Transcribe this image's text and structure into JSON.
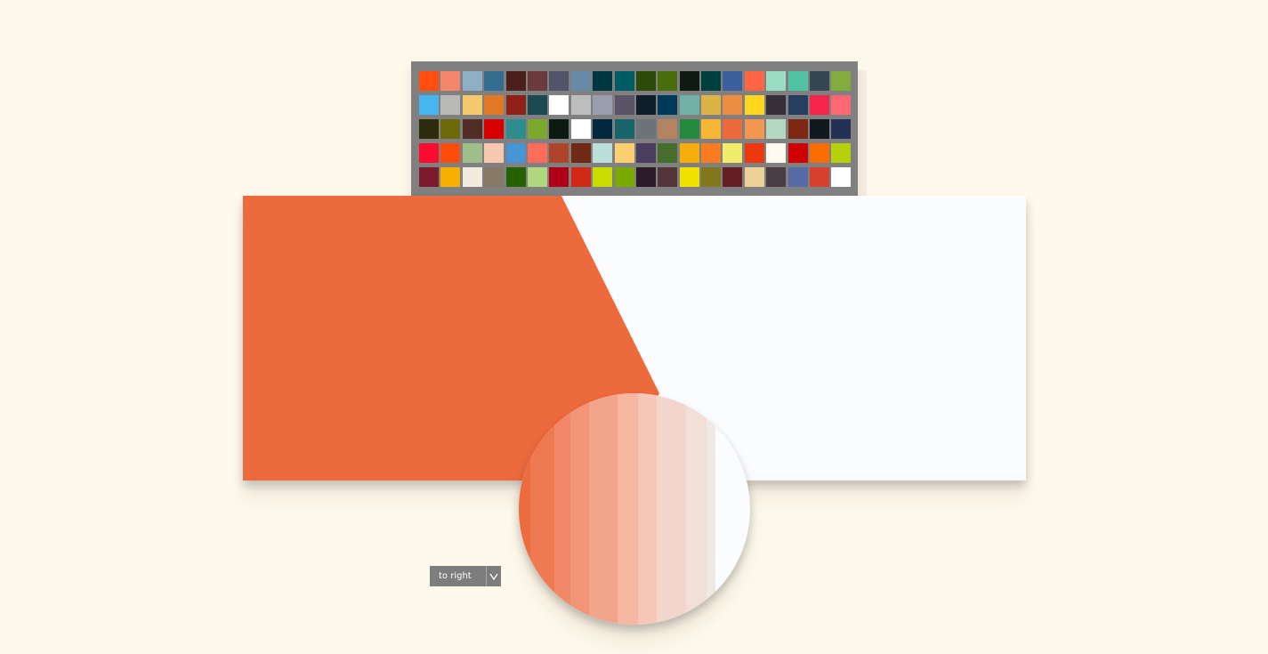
{
  "palette": {
    "swatches": [
      "#ff4e0f",
      "#f4876a",
      "#8fafc4",
      "#336e90",
      "#4a1e1a",
      "#6a3a3c",
      "#51546a",
      "#698aa6",
      "#003640",
      "#005c64",
      "#2e4a08",
      "#486e0c",
      "#0e1a12",
      "#00403c",
      "#3d5e9c",
      "#ff6543",
      "#9bdcc4",
      "#52c2a4",
      "#344752",
      "#82ac3e",
      "#46b6f0",
      "#b9b9b7",
      "#f4c86c",
      "#e07824",
      "#8e2016",
      "#1c4a52",
      "#ffffff",
      "#bdbdbd",
      "#999fad",
      "#5c5366",
      "#101e2a",
      "#00395a",
      "#70b2a6",
      "#dcb446",
      "#ee8c42",
      "#ffd81e",
      "#362e38",
      "#283e5e",
      "#f4244c",
      "#ff6872",
      "#2e2a0c",
      "#6c6a08",
      "#502d26",
      "#d60000",
      "#2e8c8c",
      "#7ca82e",
      "#0c1a14",
      "#ffffff",
      "#00283e",
      "#19646a",
      "#6c747a",
      "#b28462",
      "#268a3e",
      "#f8b637",
      "#ec6a3c",
      "#f29650",
      "#b6d8c0",
      "#7c2812",
      "#101a1e",
      "#233154",
      "#fc0c30",
      "#fe4c0a",
      "#a0be8a",
      "#f6c8b0",
      "#4696d6",
      "#fe6c5a",
      "#b0442a",
      "#6e2a14",
      "#bcded8",
      "#fcd070",
      "#4a3e5e",
      "#466c2e",
      "#f6ae0c",
      "#fa7c22",
      "#f2ec6c",
      "#ec380c",
      "#fefaf0",
      "#d00000",
      "#fc6c00",
      "#b6d00a",
      "#7c1a2e",
      "#f8b000",
      "#f2ebde",
      "#887866",
      "#246200",
      "#b0d67e",
      "#b00018",
      "#d02a16",
      "#c8dc00",
      "#78aa00",
      "#2a1a2a",
      "#54363a",
      "#f2e000",
      "#80781a",
      "#641e24",
      "#ecd296",
      "#4a3e44",
      "#586aa6",
      "#d8402e",
      "#ffffff"
    ]
  },
  "canvas": {
    "colors": {
      "left": "#ed6a3d",
      "right": "#fbfcfe"
    }
  },
  "magnifier": {
    "strips": [
      "#ec6c40",
      "#ef7a52",
      "#f18766",
      "#f29577",
      "#f3a58c",
      "#f6b6a0",
      "#f6c6b6",
      "#f2d6cc",
      "#f1e0d8",
      "#efe9e4",
      "#fbfcfe"
    ]
  },
  "direction": {
    "label": "to right",
    "chevron_icon": "chevron-down-icon"
  }
}
